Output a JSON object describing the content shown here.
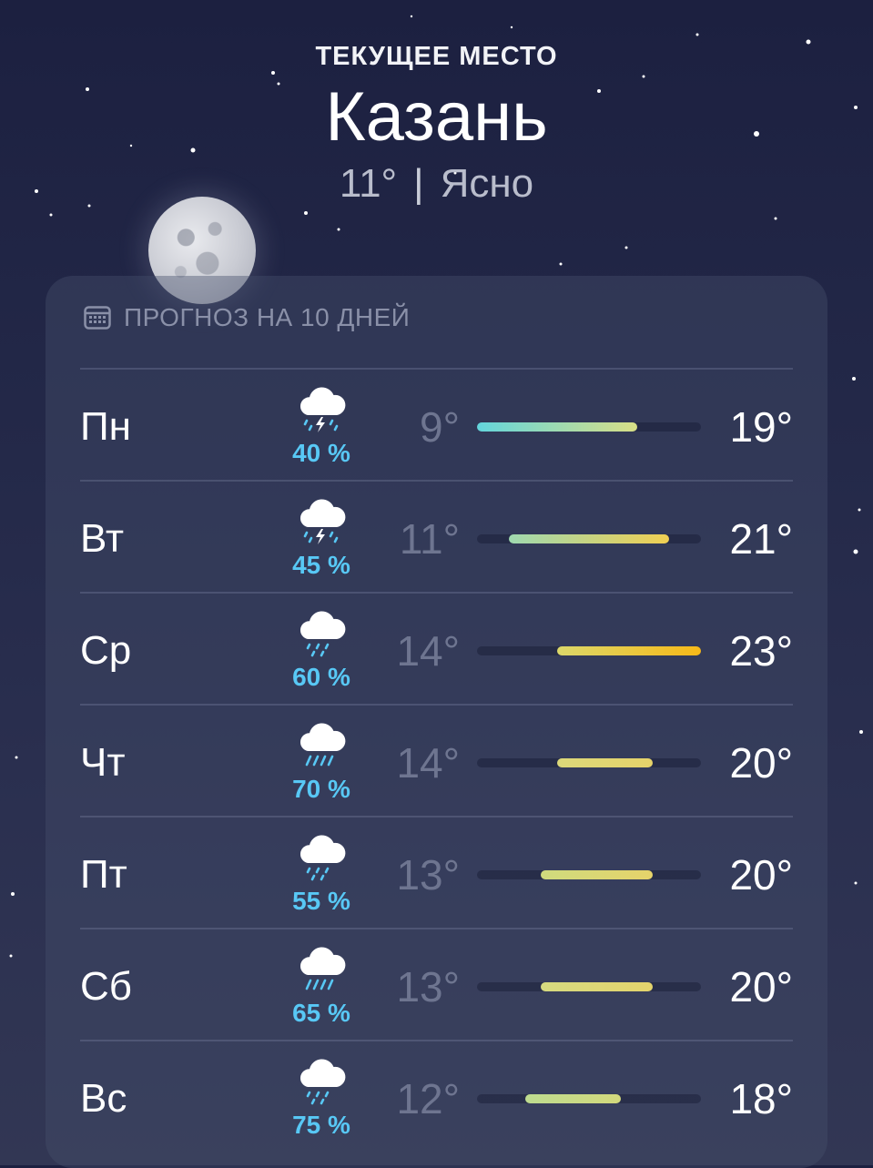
{
  "location": {
    "label": "ТЕКУЩЕЕ МЕСТО",
    "city": "Казань",
    "temperature": "11°",
    "separator": "|",
    "condition": "Ясно"
  },
  "forecast": {
    "title": "ПРОГНОЗ НА 10 ДНЕЙ",
    "days": [
      {
        "day": "Пн",
        "icon": "thunderstorm-cloud-icon",
        "precip": "40 %",
        "low": "9°",
        "high": "19°",
        "range_low": 9,
        "range_high": 19,
        "color_from": "#63d5dc",
        "color_to": "#d8df86"
      },
      {
        "day": "Вт",
        "icon": "thunderstorm-cloud-icon",
        "precip": "45 %",
        "low": "11°",
        "high": "21°",
        "range_low": 11,
        "range_high": 21,
        "color_from": "#9fd9b0",
        "color_to": "#f0cf52"
      },
      {
        "day": "Ср",
        "icon": "rain-cloud-icon",
        "precip": "60 %",
        "low": "14°",
        "high": "23°",
        "range_low": 14,
        "range_high": 23,
        "color_from": "#dcd86a",
        "color_to": "#f7b918"
      },
      {
        "day": "Чт",
        "icon": "heavy-rain-cloud-icon",
        "precip": "70 %",
        "low": "14°",
        "high": "20°",
        "range_low": 14,
        "range_high": 20,
        "color_from": "#dcd87a",
        "color_to": "#e6d36a"
      },
      {
        "day": "Пт",
        "icon": "rain-cloud-icon",
        "precip": "55 %",
        "low": "13°",
        "high": "20°",
        "range_low": 13,
        "range_high": 20,
        "color_from": "#cfdb7e",
        "color_to": "#e6d36a"
      },
      {
        "day": "Сб",
        "icon": "heavy-rain-cloud-icon",
        "precip": "65 %",
        "low": "13°",
        "high": "20°",
        "range_low": 13,
        "range_high": 20,
        "color_from": "#d6da80",
        "color_to": "#e4d46c"
      },
      {
        "day": "Вс",
        "icon": "rain-cloud-icon",
        "precip": "75 %",
        "low": "12°",
        "high": "18°",
        "range_low": 12,
        "range_high": 18,
        "color_from": "#bedc90",
        "color_to": "#d3d97c"
      }
    ]
  },
  "colors": {
    "precip": "#58c8f5",
    "low_temp": "#6e7590",
    "background": "#232848"
  }
}
